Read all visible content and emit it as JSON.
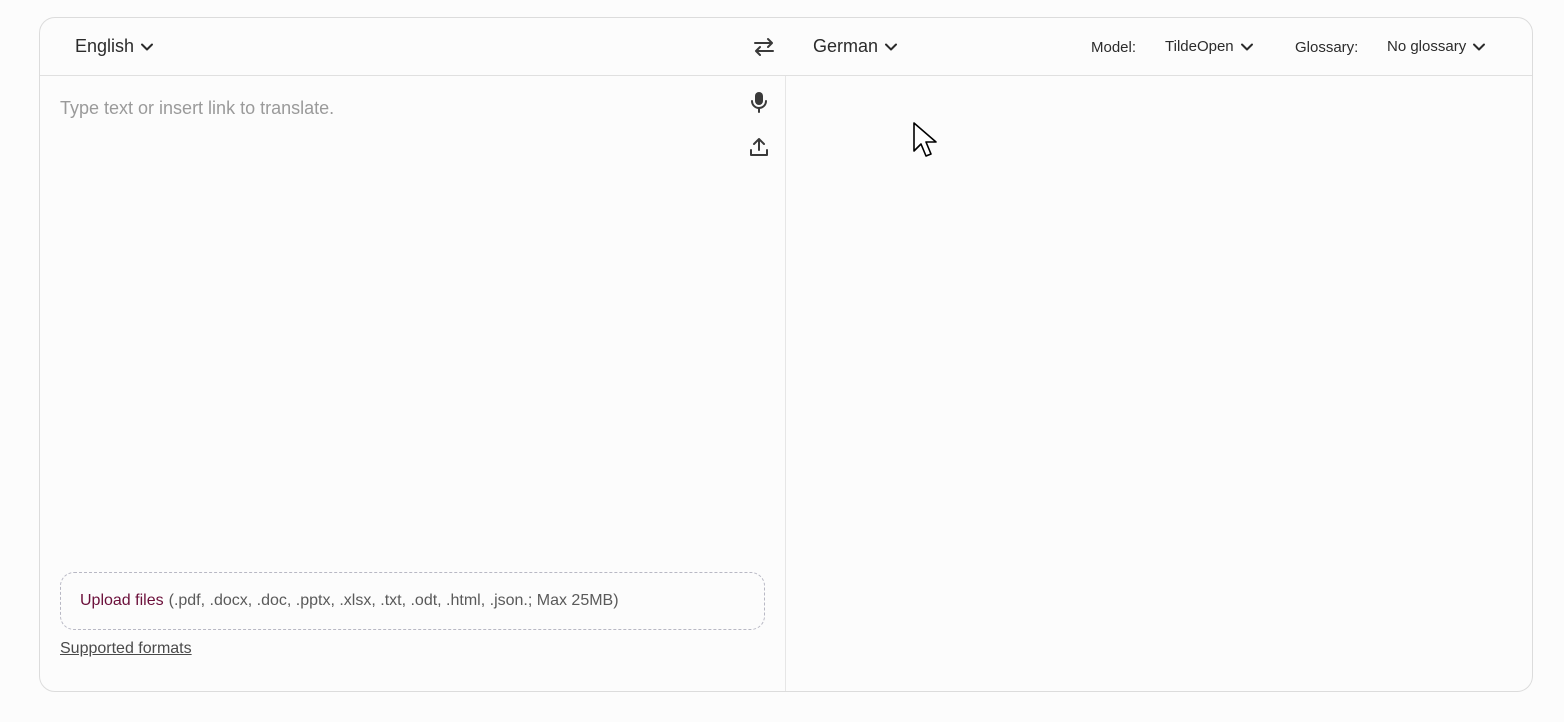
{
  "languages": {
    "source": "English",
    "target": "German"
  },
  "options": {
    "model_label": "Model:",
    "model_value": "TildeOpen",
    "glossary_label": "Glossary:",
    "glossary_value": "No glossary"
  },
  "source": {
    "placeholder": "Type text or insert link to translate.",
    "value": ""
  },
  "upload": {
    "link_label": "Upload files",
    "formats": "(.pdf, .docx, .doc, .pptx, .xlsx, .txt, .odt, .html, .json.; Max 25MB)",
    "supported_formats_label": "Supported formats"
  },
  "icons": {
    "swap": "swap-arrows-icon",
    "mic": "microphone-icon",
    "upload": "upload-icon",
    "chevron": "chevron-down-icon"
  },
  "colors": {
    "upload_link": "#6b0f3a",
    "border": "#dcdcdc",
    "placeholder": "#9a9a9a"
  }
}
